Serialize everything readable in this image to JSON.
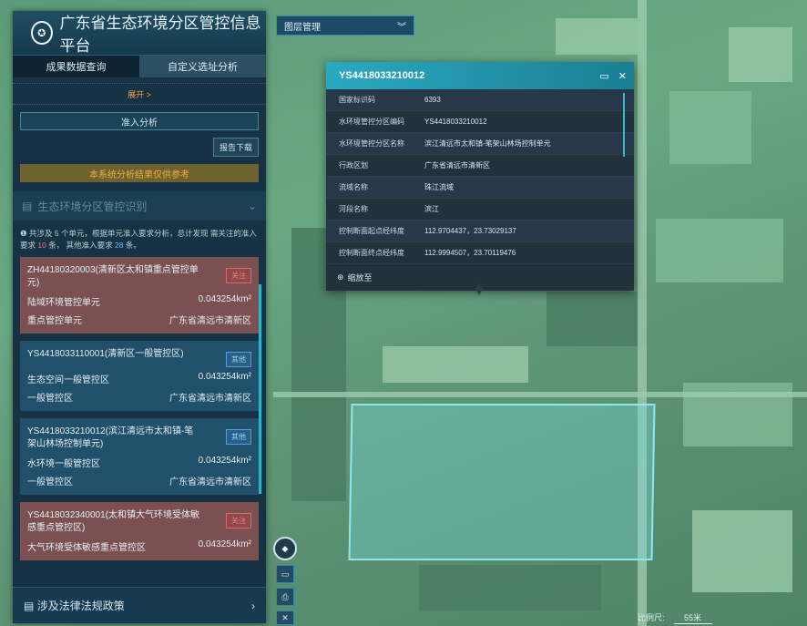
{
  "app": {
    "title": "广东省生态环境分区管控信息平台",
    "logo_icon": "emblem-icon"
  },
  "tabs": [
    {
      "label": "成果数据查询",
      "active": false
    },
    {
      "label": "自定义选址分析",
      "active": true
    }
  ],
  "expand_label": "展开 >",
  "access_label": "准入分析",
  "report_label": "报告下载",
  "notice": "本系统分析结果仅供参考",
  "section": {
    "label": "生态环境分区管控识别",
    "chevron": "chevron-down-icon"
  },
  "summary": {
    "prefix": "共涉及 5 个单元，根据单元准入要求分析，总计发现 需关注的准入要求",
    "count1": "10",
    "mid": "条， 其他准入要求",
    "count2": "28",
    "suffix": "条。"
  },
  "cards": [
    {
      "title": "ZH44180320003(清新区太和镇重点管控单元)",
      "tag": "关注",
      "tag_type": "red",
      "row1_left": "陆域环境管控单元",
      "row1_right": "0.043254km²",
      "row2_left": "重点管控单元",
      "row2_right": "广东省清远市清新区",
      "style": "red"
    },
    {
      "title": "YS4418033110001(清新区一般管控区)",
      "tag": "其他",
      "tag_type": "blue",
      "row1_left": "生态空间一般管控区",
      "row1_right": "0.043254km²",
      "row2_left": "一般管控区",
      "row2_right": "广东省清远市清新区",
      "style": "blue"
    },
    {
      "title": "YS4418033210012(滨江清远市太和镇-笔架山林场控制单元)",
      "tag": "其他",
      "tag_type": "blue",
      "row1_left": "水环境一般管控区",
      "row1_right": "0.043254km²",
      "row2_left": "一般管控区",
      "row2_right": "广东省清远市清新区",
      "style": "blue"
    },
    {
      "title": "YS4418032340001(太和镇大气环境受体敏感重点管控区)",
      "tag": "关注",
      "tag_type": "red",
      "row1_left": "大气环境受体敏感重点管控区",
      "row1_right": "0.043254km²",
      "row2_left": "",
      "row2_right": "",
      "style": "red"
    }
  ],
  "bottom_nav": {
    "label": "涉及法律法规政策",
    "chevron": "chevron-right-icon"
  },
  "layer": {
    "label": "图层管理",
    "icon": "double-chevron-down-icon"
  },
  "popup": {
    "title": "YS4418033210012",
    "rows": [
      {
        "k": "国家标识码",
        "v": "6393"
      },
      {
        "k": "水环境管控分区编码",
        "v": "YS4418033210012"
      },
      {
        "k": "水环境管控分区名称",
        "v": "滨江清远市太和镇-笔架山林场控制单元"
      },
      {
        "k": "行政区划",
        "v": "广东省清远市清新区"
      },
      {
        "k": "流域名称",
        "v": "珠江流域"
      },
      {
        "k": "河段名称",
        "v": "滨江"
      },
      {
        "k": "控制断面起点经纬度",
        "v": "112.9704437，23.73029137"
      },
      {
        "k": "控制断面终点经纬度",
        "v": "112.9994507，23.70119476"
      }
    ],
    "zoom_label": "缩放至"
  },
  "scale": {
    "label": "比例尺:",
    "value": "55米"
  }
}
